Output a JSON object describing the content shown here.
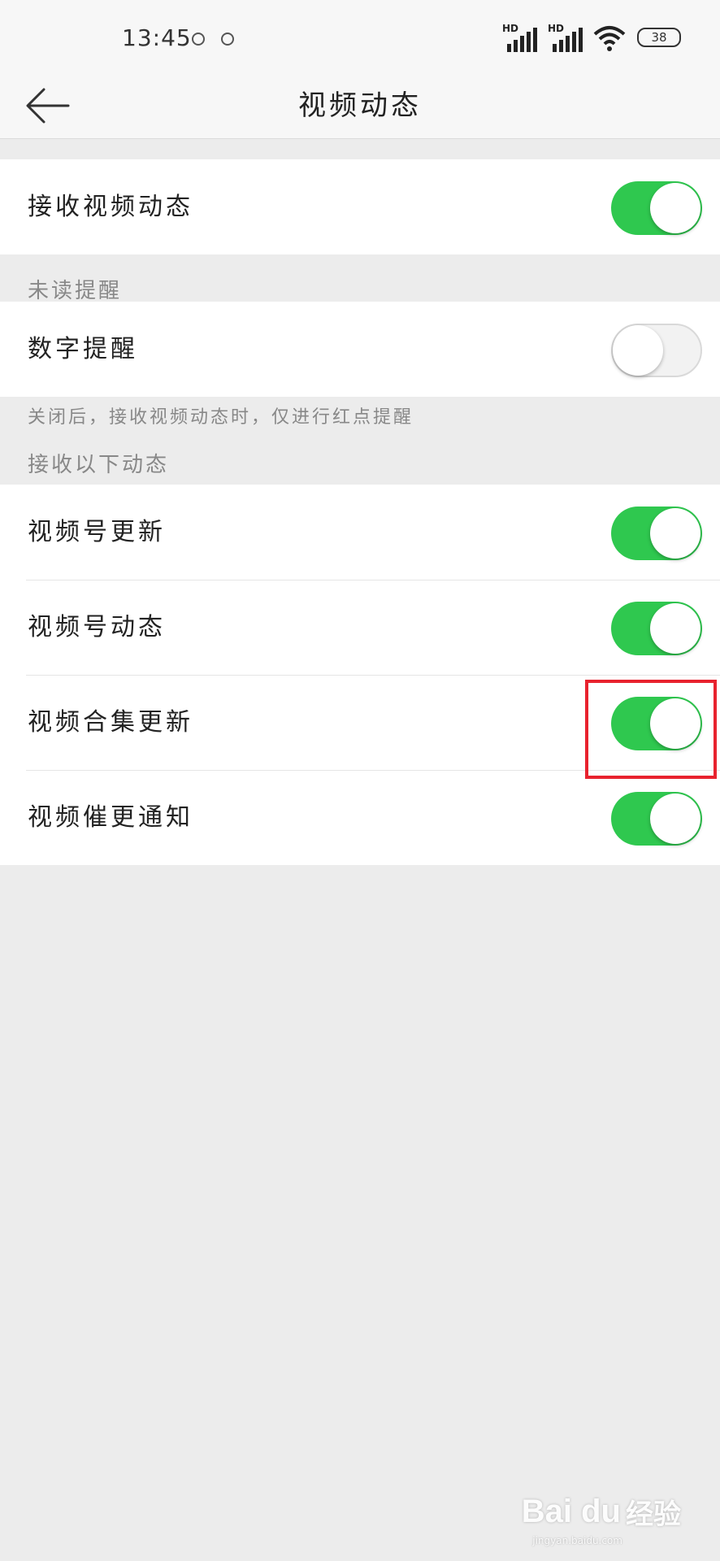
{
  "status_bar": {
    "time": "13:45",
    "signal_1_label": "HD",
    "signal_2_label": "HD",
    "battery": "38"
  },
  "nav": {
    "title": "视频动态",
    "back_icon": "arrow-left-icon"
  },
  "main_toggle": {
    "label": "接收视频动态",
    "on": true
  },
  "unread": {
    "section_label": "未读提醒",
    "items": [
      {
        "label": "数字提醒",
        "on": false
      }
    ],
    "footnote": "关闭后，接收视频动态时，仅进行红点提醒"
  },
  "receive": {
    "section_label": "接收以下动态",
    "items": [
      {
        "label": "视频号更新",
        "on": true
      },
      {
        "label": "视频号动态",
        "on": true
      },
      {
        "label": "视频合集更新",
        "on": true
      },
      {
        "label": "视频催更通知",
        "on": true
      }
    ]
  },
  "colors": {
    "switch_on": "#2fc84f",
    "highlight_box": "#e8222e",
    "background": "#ececec"
  },
  "watermark": {
    "logo": "Bai du",
    "text": "经验",
    "url": "jingyan.baidu.com"
  }
}
